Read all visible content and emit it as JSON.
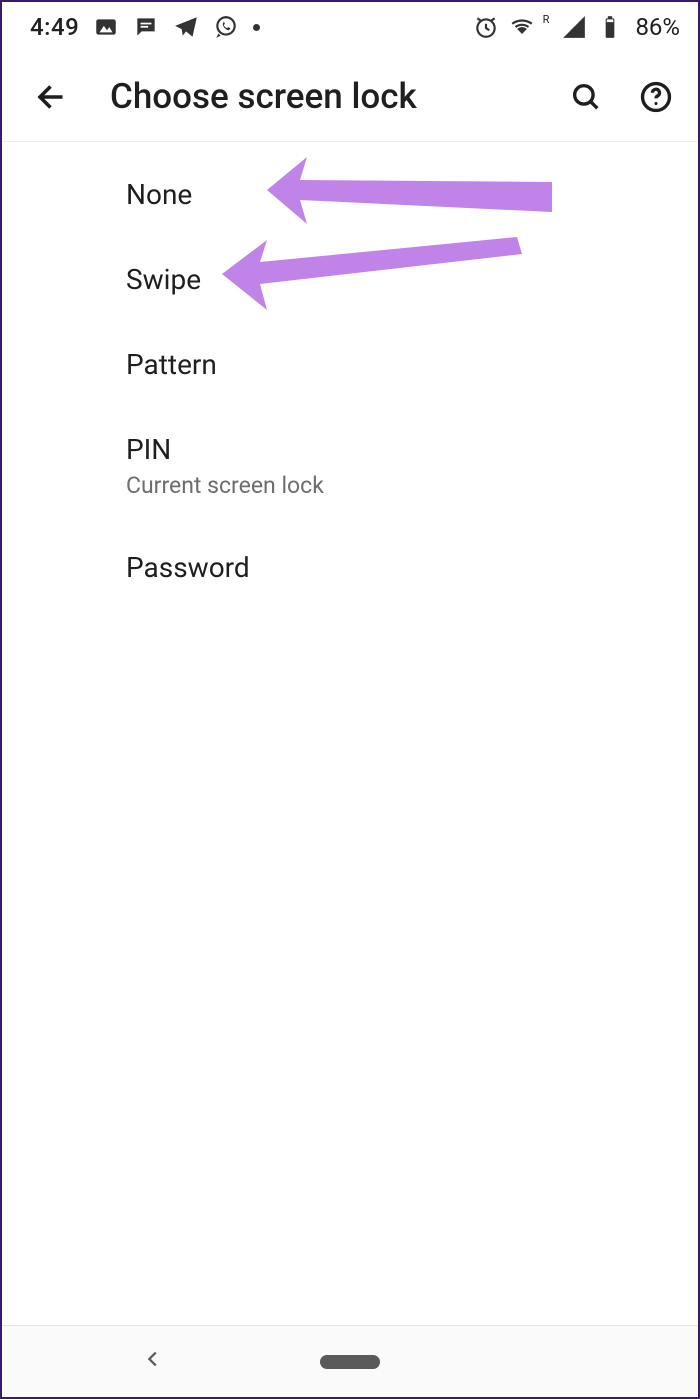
{
  "statusbar": {
    "time": "4:49",
    "battery": "86%"
  },
  "header": {
    "title": "Choose screen lock"
  },
  "options": {
    "none": "None",
    "swipe": "Swipe",
    "pattern": "Pattern",
    "pin": {
      "label": "PIN",
      "sub": "Current screen lock"
    },
    "password": "Password"
  },
  "annotation": {
    "color": "#c084e8"
  }
}
